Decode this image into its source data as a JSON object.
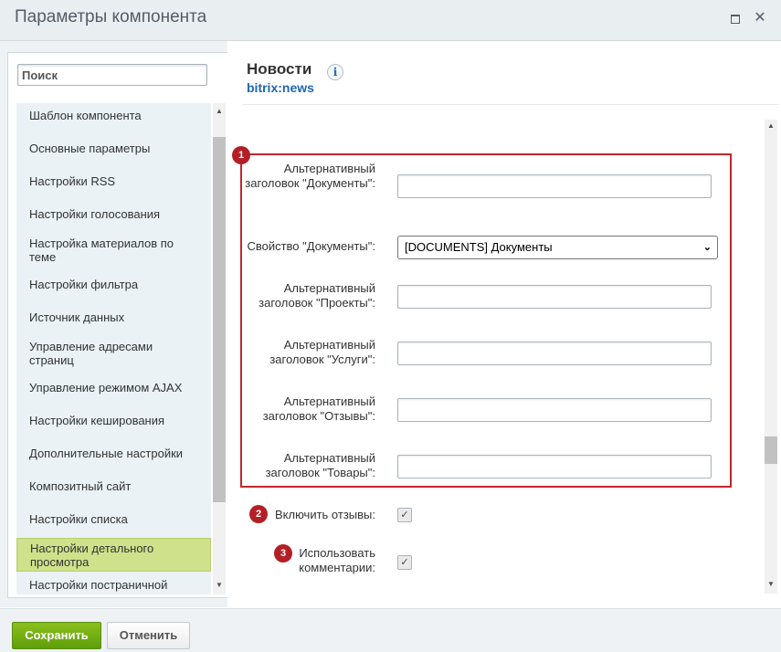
{
  "window": {
    "title": "Параметры компонента"
  },
  "sidebar": {
    "search_placeholder": "Поиск",
    "items": [
      {
        "label": "Шаблон компонента"
      },
      {
        "label": "Основные параметры"
      },
      {
        "label": "Настройки RSS"
      },
      {
        "label": "Настройки голосования"
      },
      {
        "label": "Настройка материалов по теме"
      },
      {
        "label": "Настройки фильтра"
      },
      {
        "label": "Источник данных"
      },
      {
        "label": "Управление адресами страниц"
      },
      {
        "label": "Управление режимом AJAX"
      },
      {
        "label": "Настройки кеширования"
      },
      {
        "label": "Дополнительные настройки"
      },
      {
        "label": "Композитный сайт"
      },
      {
        "label": "Настройки списка"
      },
      {
        "label": "Настройки детального просмотра",
        "active": true
      },
      {
        "label": "Настройки постраничной"
      }
    ]
  },
  "component": {
    "name": "Новости",
    "code": "bitrix:news"
  },
  "badges": {
    "b1": "1",
    "b2": "2",
    "b3": "3"
  },
  "fields": {
    "alt_docs_label": "Альтернативный заголовок \"Документы\":",
    "docs_prop_label": "Свойство \"Документы\":",
    "docs_prop_value": "[DOCUMENTS] Документы",
    "alt_projects_label": "Альтернативный заголовок \"Проекты\":",
    "alt_services_label": "Альтернативный заголовок \"Услуги\":",
    "alt_reviews_label": "Альтернативный заголовок \"Отзывы\":",
    "alt_goods_label": "Альтернативный заголовок \"Товары\":",
    "enable_reviews_label": "Включить отзывы:",
    "use_comments_label": "Использовать комментарии:"
  },
  "footer": {
    "save": "Сохранить",
    "cancel": "Отменить"
  }
}
